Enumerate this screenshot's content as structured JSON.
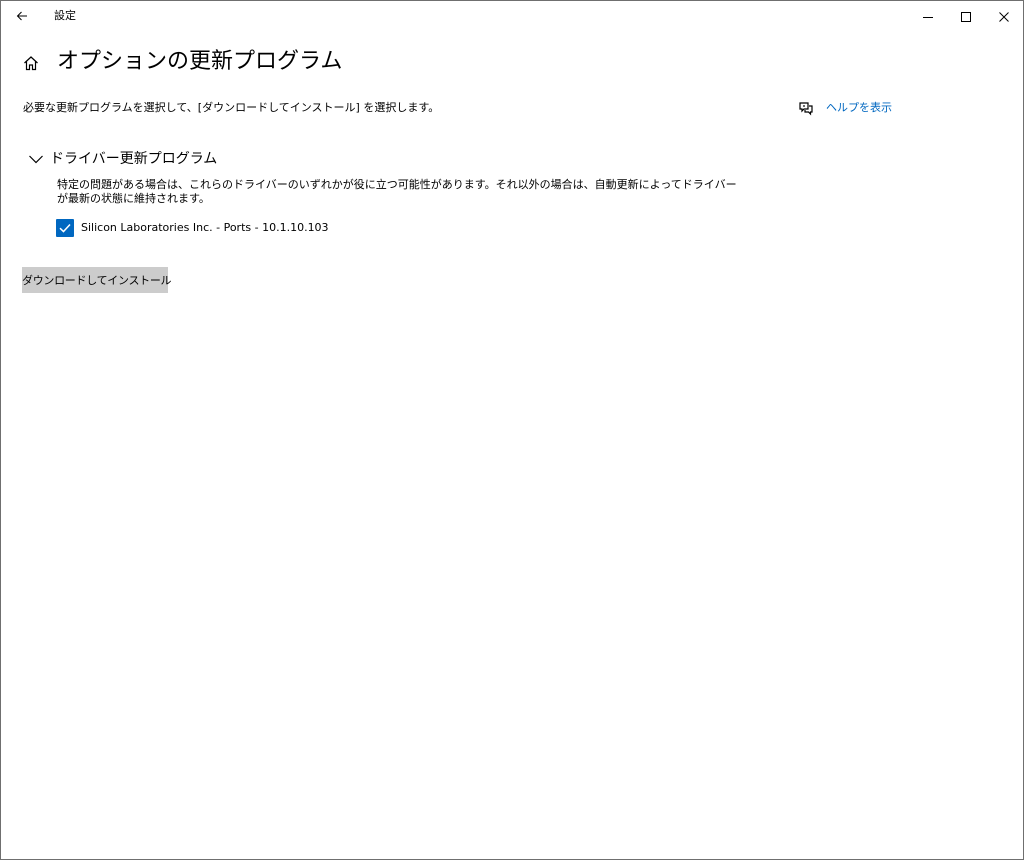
{
  "window": {
    "app_title": "設定",
    "controls": {
      "back_icon": "arrow-left-icon",
      "minimize_icon": "minimize-icon",
      "maximize_icon": "maximize-icon",
      "close_icon": "close-icon"
    }
  },
  "header": {
    "home_icon": "home-icon",
    "title": "オプションの更新プログラム"
  },
  "description": "必要な更新プログラムを選択して、[ダウンロードしてインストール] を選択します。",
  "help": {
    "icon": "chat-help-icon",
    "label": "ヘルプを表示",
    "color": "#0067c0"
  },
  "driver_section": {
    "expanded": true,
    "chevron_icon": "chevron-down-icon",
    "title": "ドライバー更新プログラム",
    "description": "特定の問題がある場合は、これらのドライバーのいずれかが役に立つ可能性があります。それ以外の場合は、自動更新によってドライバーが最新の状態に維持されます。",
    "items": [
      {
        "checked": true,
        "label": "Silicon Laboratories Inc. - Ports - 10.1.10.103"
      }
    ]
  },
  "actions": {
    "download_install_label": "ダウンロードしてインストール"
  },
  "colors": {
    "accent": "#0067c0",
    "button_bg": "#cccccc"
  }
}
